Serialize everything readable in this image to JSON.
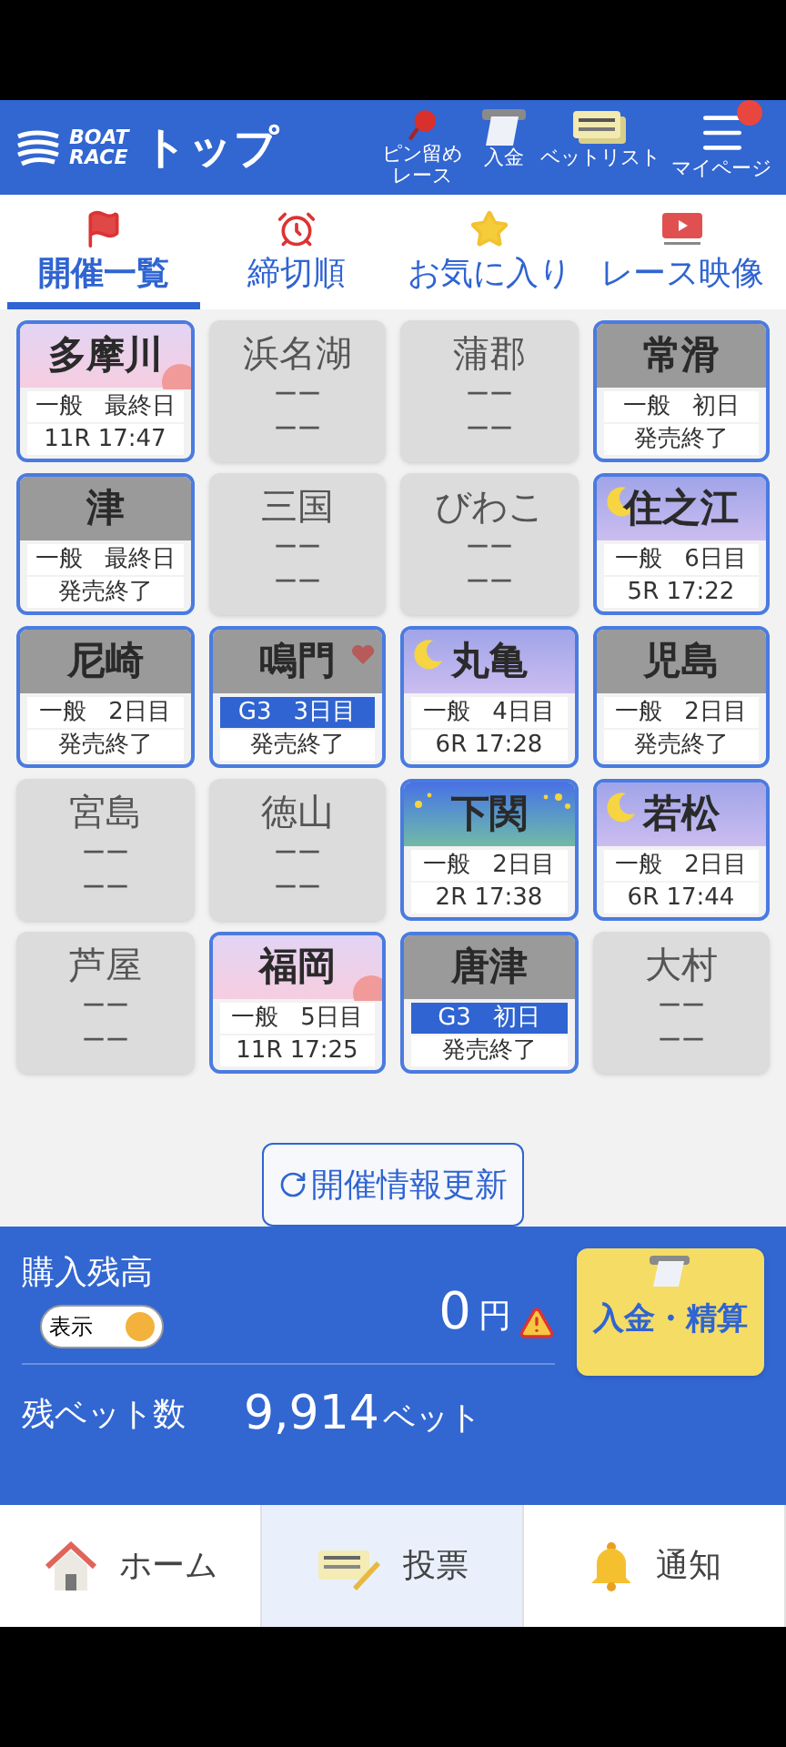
{
  "header": {
    "logo": [
      "BOAT",
      "RACE"
    ],
    "title": "トップ",
    "actions": [
      {
        "kind": "pin",
        "label": "ピン留めレース"
      },
      {
        "kind": "atm",
        "label": "入金"
      },
      {
        "kind": "tickets",
        "label": "ベットリスト"
      },
      {
        "kind": "menu",
        "label": "マイページ",
        "badge": true
      }
    ]
  },
  "tabs": [
    {
      "kind": "flag",
      "label": "開催一覧",
      "selected": true
    },
    {
      "kind": "clock",
      "label": "締切順",
      "selected": false
    },
    {
      "kind": "star",
      "label": "お気に入り",
      "selected": false
    },
    {
      "kind": "video",
      "label": "レース映像",
      "selected": false
    }
  ],
  "venues": [
    {
      "name": "多摩川",
      "kind": "sunset",
      "grade": "一般",
      "day": "最終日",
      "g3": false,
      "status": "11R 17:47",
      "favorite": false
    },
    {
      "name": "浜名湖",
      "kind": "closed",
      "lines": [
        "ーー",
        "ーー"
      ]
    },
    {
      "name": "蒲郡",
      "kind": "closed",
      "lines": [
        "ーー",
        "ーー"
      ]
    },
    {
      "name": "常滑",
      "kind": "plain",
      "grade": "一般",
      "day": "初日",
      "g3": false,
      "status": "発売終了",
      "favorite": false
    },
    {
      "name": "津",
      "kind": "plain",
      "grade": "一般",
      "day": "最終日",
      "g3": false,
      "status": "発売終了",
      "favorite": false
    },
    {
      "name": "三国",
      "kind": "closed",
      "lines": [
        "ーー",
        "ーー"
      ]
    },
    {
      "name": "びわこ",
      "kind": "closed",
      "lines": [
        "ーー",
        "ーー"
      ]
    },
    {
      "name": "住之江",
      "kind": "night",
      "grade": "一般",
      "day": "6日目",
      "g3": false,
      "status": "5R 17:22",
      "favorite": false
    },
    {
      "name": "尼崎",
      "kind": "plain",
      "grade": "一般",
      "day": "2日目",
      "g3": false,
      "status": "発売終了",
      "favorite": false
    },
    {
      "name": "鳴門",
      "kind": "plain",
      "grade": "G3",
      "day": "3日目",
      "g3": true,
      "status": "発売終了",
      "favorite": true
    },
    {
      "name": "丸亀",
      "kind": "night",
      "grade": "一般",
      "day": "4日目",
      "g3": false,
      "status": "6R 17:28",
      "favorite": false
    },
    {
      "name": "児島",
      "kind": "plain",
      "grade": "一般",
      "day": "2日目",
      "g3": false,
      "status": "発売終了",
      "favorite": false
    },
    {
      "name": "宮島",
      "kind": "closed",
      "lines": [
        "ーー",
        "ーー"
      ]
    },
    {
      "name": "徳山",
      "kind": "closed",
      "lines": [
        "ーー",
        "ーー"
      ]
    },
    {
      "name": "下関",
      "kind": "starry",
      "grade": "一般",
      "day": "2日目",
      "g3": false,
      "status": "2R 17:38",
      "favorite": false
    },
    {
      "name": "若松",
      "kind": "night",
      "grade": "一般",
      "day": "2日目",
      "g3": false,
      "status": "6R 17:44",
      "favorite": false
    },
    {
      "name": "芦屋",
      "kind": "closed",
      "lines": [
        "ーー",
        "ーー"
      ]
    },
    {
      "name": "福岡",
      "kind": "sunset",
      "grade": "一般",
      "day": "5日目",
      "g3": false,
      "status": "11R 17:25",
      "favorite": false
    },
    {
      "name": "唐津",
      "kind": "plain",
      "grade": "G3",
      "day": "初日",
      "g3": true,
      "status": "発売終了",
      "favorite": false
    },
    {
      "name": "大村",
      "kind": "closed",
      "lines": [
        "ーー",
        "ーー"
      ]
    }
  ],
  "refresh_button": "開催情報更新",
  "balance": {
    "label": "購入残高",
    "toggle": {
      "label": "表示",
      "on": true
    },
    "amount": "0",
    "unit": "円",
    "warning": true,
    "deposit_button": "入金・精算",
    "bets_label": "残ベット数",
    "bets_count": "9,914",
    "bets_unit": "ベット"
  },
  "bottom_nav": [
    {
      "kind": "home",
      "label": "ホーム",
      "selected": false
    },
    {
      "kind": "vote",
      "label": "投票",
      "selected": true
    },
    {
      "kind": "bell",
      "label": "通知",
      "selected": false
    }
  ]
}
